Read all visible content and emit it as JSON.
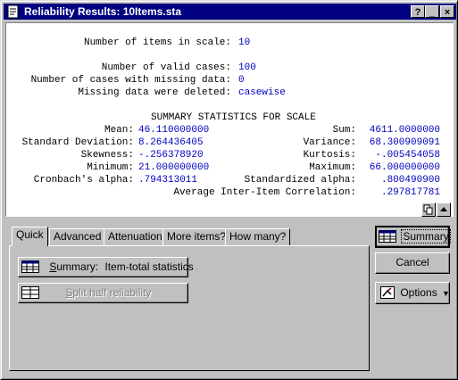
{
  "window": {
    "title": "Reliability Results: 10Items.sta",
    "controls": [
      "?",
      "_",
      "×"
    ]
  },
  "output": {
    "lines": [
      {
        "label": "Number of items in scale:",
        "value": "10"
      },
      {
        "label": "Number of valid cases:",
        "value": "100"
      },
      {
        "label": "Number of cases with missing data:",
        "value": "0"
      },
      {
        "label": "Missing data were deleted:",
        "value": "casewise"
      }
    ],
    "summary_heading": "SUMMARY STATISTICS FOR SCALE",
    "stats": [
      {
        "label": "Mean:",
        "value": "46.110000000",
        "label2": "Sum:",
        "value2": "4611.0000000"
      },
      {
        "label": "Standard Deviation:",
        "value": "8.264436405",
        "label2": "Variance:",
        "value2": "68.300909091"
      },
      {
        "label": "Skewness:",
        "value": "-.256378920",
        "label2": "Kurtosis:",
        "value2": "-.005454058"
      },
      {
        "label": "Minimum:",
        "value": "21.000000000",
        "label2": "Maximum:",
        "value2": "66.000000000"
      },
      {
        "label": "Cronbach's alpha:",
        "value": ".794313011",
        "label2": "Standardized alpha:",
        "value2": ".800490900"
      }
    ],
    "avg_corr_label": "Average Inter-Item Correlation:",
    "avg_corr_value": ".297817781"
  },
  "tabs": [
    "Quick",
    "Advanced",
    "Attenuation",
    "More items?",
    "How many?"
  ],
  "active_tab": "Quick",
  "quick": {
    "summary_button_hotkey": "S",
    "summary_button_rest": "ummary:",
    "summary_button_suffix": "Item-total statistics",
    "split_half_hotkey": "S",
    "split_half_rest": "plit half reliability"
  },
  "right_buttons": {
    "summary": "Summary",
    "cancel": "Cancel",
    "options": "Options"
  },
  "colors": {
    "titlebar": "#000080",
    "value_text": "#0000c0",
    "face": "#c0c0c0"
  }
}
